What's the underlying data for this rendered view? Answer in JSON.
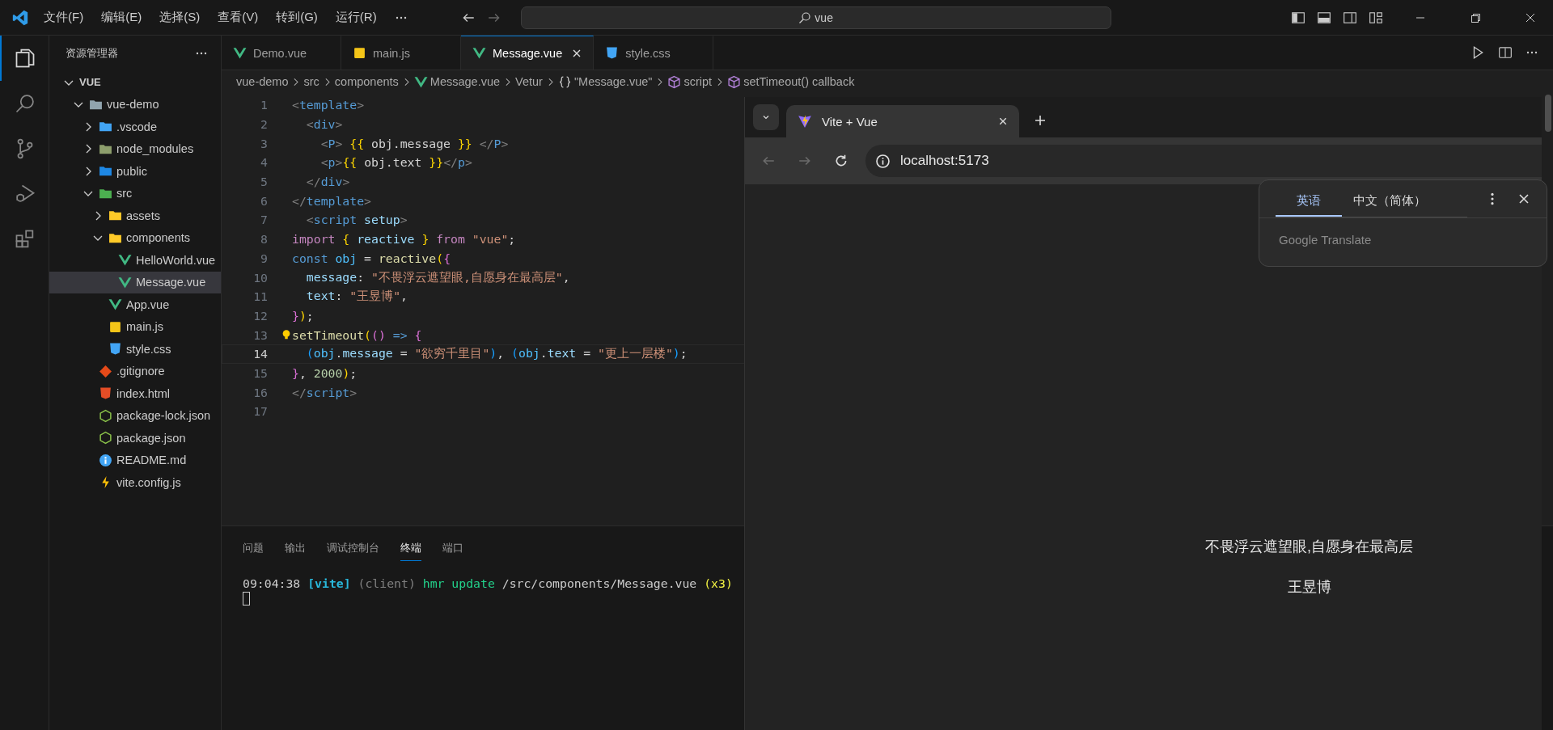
{
  "title_bar": {
    "menu": [
      "文件(F)",
      "编辑(E)",
      "选择(S)",
      "查看(V)",
      "转到(G)",
      "运行(R)"
    ],
    "search": {
      "value": "vue"
    }
  },
  "activity_bar": [
    {
      "kind": "explorer",
      "selected": true
    },
    {
      "kind": "search",
      "selected": false
    },
    {
      "kind": "source-control",
      "selected": false
    },
    {
      "kind": "run-debug",
      "selected": false
    },
    {
      "kind": "extensions",
      "selected": false
    }
  ],
  "explorer": {
    "title": "资源管理器",
    "tree": [
      {
        "label": "VUE",
        "kind": "root",
        "expanded": true,
        "selected": false,
        "children": [
          {
            "label": "vue-demo",
            "kind": "folder",
            "expanded": true,
            "selected": false,
            "children": [
              {
                "label": ".vscode",
                "kind": "folder-vscode",
                "expanded": false,
                "selected": false
              },
              {
                "label": "node_modules",
                "kind": "folder-node",
                "expanded": false,
                "selected": false
              },
              {
                "label": "public",
                "kind": "folder-public",
                "expanded": false,
                "selected": false
              },
              {
                "label": "src",
                "kind": "folder-src",
                "expanded": true,
                "selected": false,
                "children": [
                  {
                    "label": "assets",
                    "kind": "folder-assets",
                    "expanded": false,
                    "selected": false
                  },
                  {
                    "label": "components",
                    "kind": "folder-components",
                    "expanded": true,
                    "selected": false,
                    "children": [
                      {
                        "label": "HelloWorld.vue",
                        "kind": "vue",
                        "selected": false
                      },
                      {
                        "label": "Message.vue",
                        "kind": "vue",
                        "selected": true
                      }
                    ]
                  },
                  {
                    "label": "App.vue",
                    "kind": "vue",
                    "selected": false
                  },
                  {
                    "label": "main.js",
                    "kind": "js",
                    "selected": false
                  },
                  {
                    "label": "style.css",
                    "kind": "css",
                    "selected": false
                  }
                ]
              },
              {
                "label": ".gitignore",
                "kind": "git",
                "selected": false
              },
              {
                "label": "index.html",
                "kind": "html",
                "selected": false
              },
              {
                "label": "package-lock.json",
                "kind": "json",
                "selected": false
              },
              {
                "label": "package.json",
                "kind": "json",
                "selected": false
              },
              {
                "label": "README.md",
                "kind": "info",
                "selected": false
              },
              {
                "label": "vite.config.js",
                "kind": "vite",
                "selected": false
              }
            ]
          }
        ]
      }
    ]
  },
  "editor_tabs": [
    {
      "label": "Demo.vue",
      "kind": "vue",
      "selected": false
    },
    {
      "label": "main.js",
      "kind": "js",
      "selected": false
    },
    {
      "label": "Message.vue",
      "kind": "vue",
      "selected": true
    },
    {
      "label": "style.css",
      "kind": "css",
      "selected": false
    }
  ],
  "breadcrumb": [
    {
      "label": "vue-demo",
      "kind": "plain"
    },
    {
      "label": "src",
      "kind": "plain"
    },
    {
      "label": "components",
      "kind": "plain"
    },
    {
      "label": "Message.vue",
      "kind": "vue"
    },
    {
      "label": "Vetur",
      "kind": "plain"
    },
    {
      "label": "\"Message.vue\"",
      "kind": "braces"
    },
    {
      "label": "script",
      "kind": "cube"
    },
    {
      "label": "setTimeout() callback",
      "kind": "cube"
    }
  ],
  "code": [
    {
      "number": "1",
      "current": false,
      "tokens": [
        {
          "t": "<",
          "kind": "bracket"
        },
        {
          "t": "template",
          "kind": "tag"
        },
        {
          "t": ">",
          "kind": "bracket"
        }
      ]
    },
    {
      "number": "2",
      "current": false,
      "tokens": [
        {
          "t": "  <",
          "kind": "bracket"
        },
        {
          "t": "div",
          "kind": "tag"
        },
        {
          "t": ">",
          "kind": "bracket"
        }
      ]
    },
    {
      "number": "3",
      "current": false,
      "tokens": [
        {
          "t": "    <",
          "kind": "bracket"
        },
        {
          "t": "P",
          "kind": "tag"
        },
        {
          "t": "> ",
          "kind": "bracket"
        },
        {
          "t": "{{",
          "kind": "brace1"
        },
        {
          "t": " obj.message ",
          "kind": "plain"
        },
        {
          "t": "}}",
          "kind": "brace1"
        },
        {
          "t": " </",
          "kind": "bracket"
        },
        {
          "t": "P",
          "kind": "tag"
        },
        {
          "t": ">",
          "kind": "bracket"
        }
      ]
    },
    {
      "number": "4",
      "current": false,
      "tokens": [
        {
          "t": "    <",
          "kind": "bracket"
        },
        {
          "t": "p",
          "kind": "tag"
        },
        {
          "t": ">",
          "kind": "bracket"
        },
        {
          "t": "{{",
          "kind": "brace1"
        },
        {
          "t": " obj.text ",
          "kind": "plain"
        },
        {
          "t": "}}",
          "kind": "brace1"
        },
        {
          "t": "</",
          "kind": "bracket"
        },
        {
          "t": "p",
          "kind": "tag"
        },
        {
          "t": ">",
          "kind": "bracket"
        }
      ]
    },
    {
      "number": "5",
      "current": false,
      "tokens": [
        {
          "t": "  </",
          "kind": "bracket"
        },
        {
          "t": "div",
          "kind": "tag"
        },
        {
          "t": ">",
          "kind": "bracket"
        }
      ]
    },
    {
      "number": "6",
      "current": false,
      "tokens": [
        {
          "t": "</",
          "kind": "bracket"
        },
        {
          "t": "template",
          "kind": "tag"
        },
        {
          "t": ">",
          "kind": "bracket"
        }
      ]
    },
    {
      "number": "7",
      "current": false,
      "tokens": [
        {
          "t": "  <",
          "kind": "bracket"
        },
        {
          "t": "script",
          "kind": "tag"
        },
        {
          "t": " setup",
          "kind": "attr"
        },
        {
          "t": ">",
          "kind": "bracket"
        }
      ]
    },
    {
      "number": "8",
      "current": false,
      "tokens": [
        {
          "t": "import ",
          "kind": "keyword"
        },
        {
          "t": "{",
          "kind": "brace1"
        },
        {
          "t": " reactive ",
          "kind": "prop"
        },
        {
          "t": "}",
          "kind": "brace1"
        },
        {
          "t": " from ",
          "kind": "keyword"
        },
        {
          "t": "\"vue\"",
          "kind": "string"
        },
        {
          "t": ";",
          "kind": "plain"
        }
      ]
    },
    {
      "number": "9",
      "current": false,
      "tokens": [
        {
          "t": "const ",
          "kind": "storage"
        },
        {
          "t": "obj",
          "kind": "const"
        },
        {
          "t": " = ",
          "kind": "plain"
        },
        {
          "t": "reactive",
          "kind": "func"
        },
        {
          "t": "(",
          "kind": "brace1"
        },
        {
          "t": "{",
          "kind": "brace2"
        }
      ]
    },
    {
      "number": "10",
      "current": false,
      "tokens": [
        {
          "t": "  message",
          "kind": "prop"
        },
        {
          "t": ": ",
          "kind": "plain"
        },
        {
          "t": "\"不畏浮云遮望眼,自愿身在最高层\"",
          "kind": "string"
        },
        {
          "t": ",",
          "kind": "plain"
        }
      ]
    },
    {
      "number": "11",
      "current": false,
      "tokens": [
        {
          "t": "  text",
          "kind": "prop"
        },
        {
          "t": ": ",
          "kind": "plain"
        },
        {
          "t": "\"王昱博\"",
          "kind": "string"
        },
        {
          "t": ",",
          "kind": "plain"
        }
      ]
    },
    {
      "number": "12",
      "current": false,
      "tokens": [
        {
          "t": "}",
          "kind": "brace2"
        },
        {
          "t": ")",
          "kind": "brace1"
        },
        {
          "t": ";",
          "kind": "plain"
        }
      ]
    },
    {
      "number": "13",
      "current": false,
      "tokens": [
        {
          "t": "setTimeout",
          "kind": "func"
        },
        {
          "t": "(",
          "kind": "brace1"
        },
        {
          "t": "()",
          "kind": "brace2"
        },
        {
          "t": " => ",
          "kind": "storage"
        },
        {
          "t": "{",
          "kind": "brace2"
        }
      ]
    },
    {
      "number": "14",
      "current": true,
      "tokens": [
        {
          "t": "  (",
          "kind": "brace3"
        },
        {
          "t": "obj",
          "kind": "const"
        },
        {
          "t": ".",
          "kind": "plain"
        },
        {
          "t": "message",
          "kind": "prop"
        },
        {
          "t": " = ",
          "kind": "plain"
        },
        {
          "t": "\"欲穷千里目\"",
          "kind": "string"
        },
        {
          "t": ")",
          "kind": "brace3"
        },
        {
          "t": ", ",
          "kind": "plain"
        },
        {
          "t": "(",
          "kind": "brace3"
        },
        {
          "t": "obj",
          "kind": "const"
        },
        {
          "t": ".",
          "kind": "plain"
        },
        {
          "t": "text",
          "kind": "prop"
        },
        {
          "t": " = ",
          "kind": "plain"
        },
        {
          "t": "\"更上一层楼\"",
          "kind": "string"
        },
        {
          "t": ")",
          "kind": "brace3"
        },
        {
          "t": ";",
          "kind": "plain"
        }
      ]
    },
    {
      "number": "15",
      "current": false,
      "tokens": [
        {
          "t": "}",
          "kind": "brace2"
        },
        {
          "t": ", ",
          "kind": "plain"
        },
        {
          "t": "2000",
          "kind": "number"
        },
        {
          "t": ")",
          "kind": "brace1"
        },
        {
          "t": ";",
          "kind": "plain"
        }
      ]
    },
    {
      "number": "16",
      "current": false,
      "tokens": [
        {
          "t": "</",
          "kind": "bracket"
        },
        {
          "t": "script",
          "kind": "tag"
        },
        {
          "t": ">",
          "kind": "bracket"
        }
      ]
    },
    {
      "number": "17",
      "current": false
    }
  ],
  "panel": {
    "tabs": [
      {
        "label": "问题",
        "selected": false
      },
      {
        "label": "输出",
        "selected": false
      },
      {
        "label": "调试控制台",
        "selected": false
      },
      {
        "label": "终端",
        "selected": true
      },
      {
        "label": "端口",
        "selected": false
      }
    ],
    "terminal": [
      {
        "t": "09:04:38 ",
        "kind": "plain"
      },
      {
        "t": "[vite]",
        "kind": "cyan"
      },
      {
        "t": " (client) ",
        "kind": "dim"
      },
      {
        "t": "hmr update ",
        "kind": "green"
      },
      {
        "t": "/src/components/Message.vue ",
        "kind": "plain"
      },
      {
        "t": "(x3)",
        "kind": "yellow"
      }
    ]
  },
  "browser": {
    "tab": {
      "title": "Vite + Vue"
    },
    "nav": [
      {
        "kind": "back",
        "disabled": true
      },
      {
        "kind": "forward",
        "disabled": true
      },
      {
        "kind": "reload",
        "disabled": false
      }
    ],
    "url": "localhost:5173",
    "translate_popup": {
      "tabs": [
        {
          "label": "英语",
          "selected": true
        },
        {
          "label": "中文（简体）",
          "selected": false
        }
      ],
      "brand": "Google Translate"
    },
    "page": {
      "lines": [
        "不畏浮云遮望眼,自愿身在最高层",
        "王昱博"
      ]
    }
  }
}
